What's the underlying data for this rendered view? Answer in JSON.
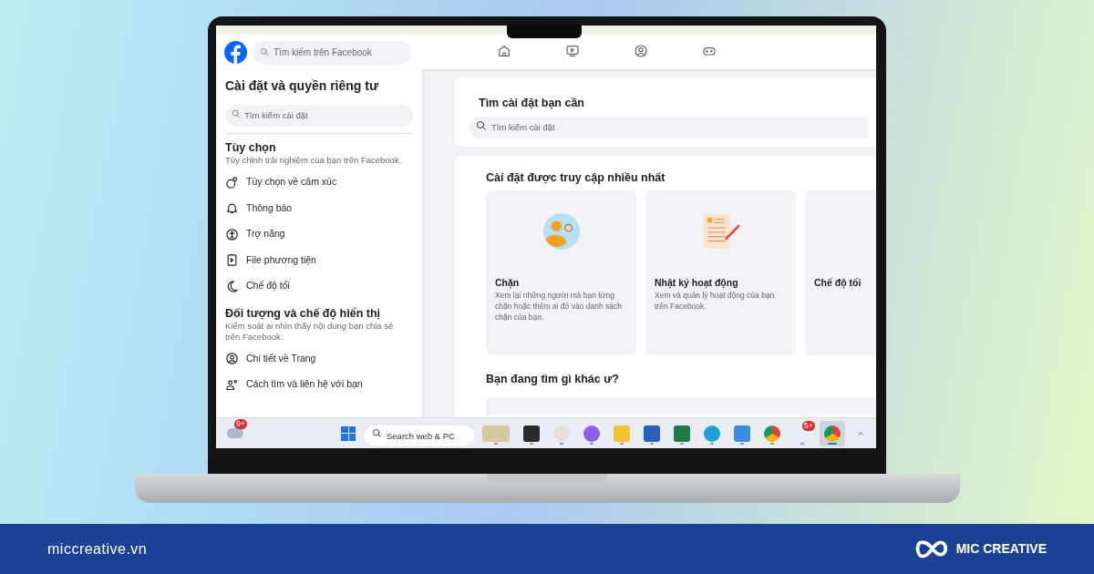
{
  "header": {
    "search": {
      "placeholder": "Tìm kiếm trên Facebook"
    },
    "nav": [
      {
        "kind": "home",
        "selected": false
      },
      {
        "kind": "video",
        "selected": false
      },
      {
        "kind": "people",
        "selected": false
      },
      {
        "kind": "game",
        "selected": false
      }
    ]
  },
  "sidebar": {
    "title": "Cài đặt và quyền riêng tư",
    "search": {
      "placeholder": "Tìm kiếm cài đặt"
    },
    "sections": [
      {
        "title": "Tùy chọn",
        "description": "Tùy chỉnh trải nghiệm của bạn trên Facebook.",
        "items": [
          {
            "kind": "reaction",
            "label": "Tùy chọn về cảm xúc"
          },
          {
            "kind": "bell",
            "label": "Thông báo"
          },
          {
            "kind": "accessibility",
            "label": "Trợ năng"
          },
          {
            "kind": "media",
            "label": "File phương tiện"
          },
          {
            "kind": "moon",
            "label": "Chế độ tối"
          }
        ]
      },
      {
        "title": "Đối tượng và chế độ hiển thị",
        "description": "Kiểm soát ai nhìn thấy nội dung bạn chia sẻ trên Facebook.",
        "items": [
          {
            "kind": "profile",
            "label": "Chi tiết về Trang"
          },
          {
            "kind": "contacts",
            "label": "Cách tìm và liên hệ với bạn"
          }
        ]
      }
    ]
  },
  "main": {
    "search_card": {
      "title": "Tìm cài đặt bạn cần",
      "placeholder": "Tìm kiếm cài đặt"
    },
    "most_visited": {
      "title": "Cài đặt được truy cập nhiều nhất",
      "cards": [
        {
          "kind": "block",
          "title": "Chặn",
          "description": "Xem lại những người mà bạn từng chặn hoặc thêm ai đó vào danh sách chặn của bạn."
        },
        {
          "kind": "log",
          "title": "Nhật ký hoạt động",
          "description": "Xem và quản lý hoạt động của bạn trên Facebook."
        },
        {
          "kind": "dark",
          "title": "Chế độ tối"
        }
      ]
    },
    "other_title": "Bạn đang tìm gì khác ư?"
  },
  "taskbar": {
    "weather_badge": "9+",
    "search_placeholder": "Search web & PC",
    "apps": [
      {
        "kind": "widget",
        "selected": false
      },
      {
        "kind": "terminal",
        "selected": false
      },
      {
        "kind": "elephant",
        "selected": false
      },
      {
        "kind": "copilot",
        "selected": false
      },
      {
        "kind": "folder",
        "selected": false
      },
      {
        "kind": "word",
        "selected": false
      },
      {
        "kind": "excel",
        "selected": false
      },
      {
        "kind": "edge",
        "selected": false
      },
      {
        "kind": "bird",
        "selected": false
      },
      {
        "kind": "chrome",
        "selected": false
      },
      {
        "kind": "chat",
        "badge": "5+",
        "selected": false
      },
      {
        "kind": "chrome",
        "selected": true
      }
    ]
  },
  "footer": {
    "site": "miccreative.vn",
    "brand": "MIC CREATIVE"
  }
}
